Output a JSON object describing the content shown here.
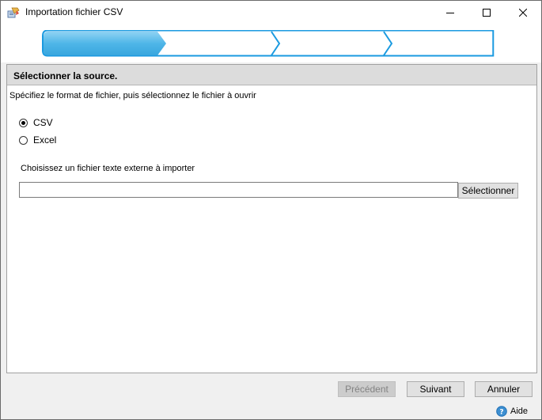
{
  "window": {
    "title": "Importation fichier CSV",
    "controls": {
      "minimize": "minimize-icon",
      "maximize": "maximize-icon",
      "close": "close-icon"
    }
  },
  "wizard": {
    "steps": [
      "step-1",
      "step-2",
      "step-3",
      "step-4"
    ],
    "current_step": 1,
    "active_color": "#4fb6e8",
    "border_color": "#1a9ae0"
  },
  "section": {
    "title": "Sélectionner la source.",
    "instruction": "Spécifiez le format de fichier, puis sélectionnez le fichier à ouvrir"
  },
  "format": {
    "options": [
      {
        "label": "CSV",
        "checked": true
      },
      {
        "label": "Excel",
        "checked": false
      }
    ]
  },
  "file": {
    "label": "Choisissez un fichier texte externe à importer",
    "value": "",
    "browse_label": "Sélectionner"
  },
  "footer": {
    "previous_label": "Précédent",
    "next_label": "Suivant",
    "cancel_label": "Annuler",
    "help_label": "Aide"
  }
}
